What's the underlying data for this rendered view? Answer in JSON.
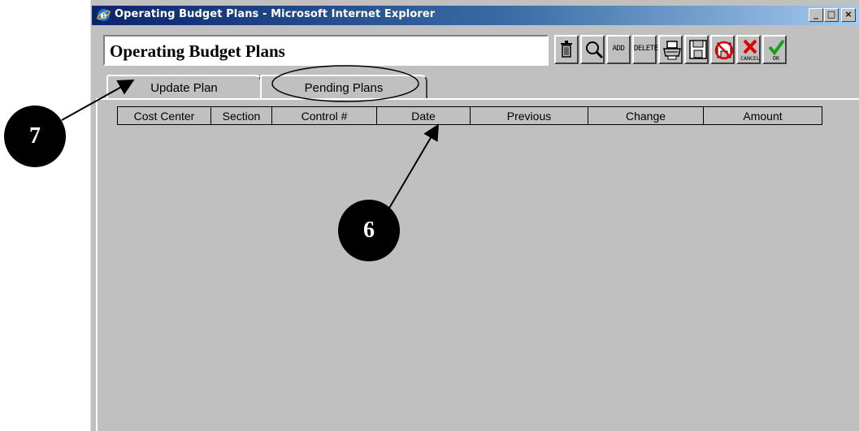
{
  "window": {
    "title": "Operating Budget Plans - Microsoft Internet Explorer",
    "controls": [
      "_",
      "□",
      "×"
    ]
  },
  "header": {
    "title": "Operating Budget Plans",
    "toolbar": [
      {
        "name": "delete-trash-icon",
        "label": ""
      },
      {
        "name": "search-icon",
        "label": ""
      },
      {
        "name": "add-button",
        "label": "ADD"
      },
      {
        "name": "delete-button",
        "label": "DELETE"
      },
      {
        "name": "print-icon",
        "label": ""
      },
      {
        "name": "save-icon",
        "label": ""
      },
      {
        "name": "no-save-icon",
        "label": ""
      },
      {
        "name": "cancel-button",
        "label": "CANCEL"
      },
      {
        "name": "ok-button",
        "label": "OK"
      }
    ]
  },
  "tabs": [
    {
      "label": "Update Plan"
    },
    {
      "label": "Pending Plans"
    }
  ],
  "table": {
    "columns": [
      "Cost Center",
      "Section",
      "Control #",
      "Date",
      "Previous",
      "Change",
      "Amount"
    ]
  },
  "callouts": [
    {
      "label": "7"
    },
    {
      "label": "6"
    }
  ]
}
